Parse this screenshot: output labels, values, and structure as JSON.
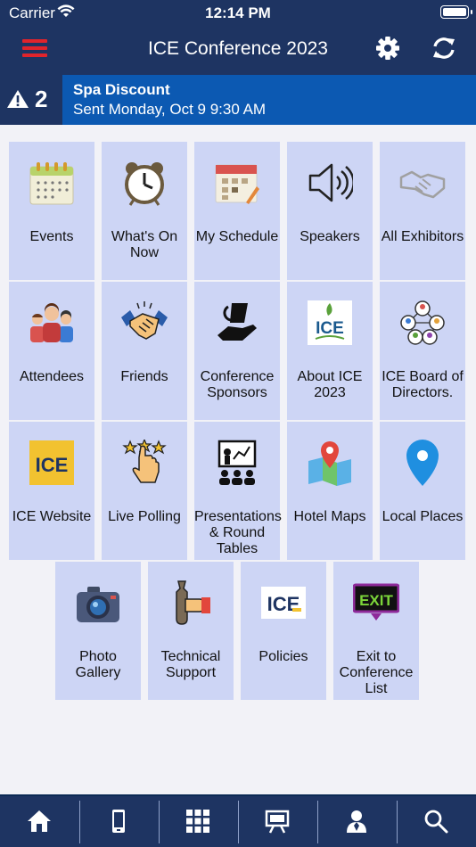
{
  "status_bar": {
    "carrier": "Carrier",
    "time": "12:14 PM"
  },
  "nav": {
    "title": "ICE Conference 2023"
  },
  "alert": {
    "count": "2",
    "title": "Spa Discount",
    "subtitle": "Sent Monday, Oct 9 9:30 AM"
  },
  "tiles": [
    {
      "label": "Events",
      "icon": "calendar-icon"
    },
    {
      "label": "What's On Now",
      "icon": "alarm-clock-icon"
    },
    {
      "label": "My Schedule",
      "icon": "schedule-calendar-icon"
    },
    {
      "label": "Speakers",
      "icon": "speaker-icon"
    },
    {
      "label": "All Exhibitors",
      "icon": "handshake-outline-icon"
    },
    {
      "label": "Attendees",
      "icon": "people-group-icon"
    },
    {
      "label": "Friends",
      "icon": "handshake-icon"
    },
    {
      "label": "Conference Sponsors",
      "icon": "sponsor-hand-icon"
    },
    {
      "label": "About ICE 2023",
      "icon": "ice-logo-icon",
      "logo_text": "ICE"
    },
    {
      "label": "ICE Board of Directors.",
      "icon": "network-people-icon"
    },
    {
      "label": "ICE Website",
      "icon": "ice-website-logo-icon",
      "logo_text": "ICE"
    },
    {
      "label": "Live Polling",
      "icon": "star-hand-icon"
    },
    {
      "label": "Presentations & Round Tables",
      "icon": "presentation-icon"
    },
    {
      "label": "Hotel Maps",
      "icon": "map-pin-icon"
    },
    {
      "label": "Local Places",
      "icon": "location-pin-icon"
    },
    {
      "label": "Photo Gallery",
      "icon": "camera-icon"
    },
    {
      "label": "Technical Support",
      "icon": "wrench-hand-icon"
    },
    {
      "label": "Policies",
      "icon": "ice-policies-logo-icon",
      "logo_text": "ICE"
    },
    {
      "label": "Exit to Conference List",
      "icon": "exit-sign-icon",
      "logo_text": "EXIT"
    }
  ],
  "tab_bar": [
    {
      "name": "tab-home",
      "icon": "home-icon"
    },
    {
      "name": "tab-mobile",
      "icon": "phone-icon"
    },
    {
      "name": "tab-grid",
      "icon": "grid-icon"
    },
    {
      "name": "tab-presentation",
      "icon": "easel-icon"
    },
    {
      "name": "tab-profile",
      "icon": "person-icon"
    },
    {
      "name": "tab-search",
      "icon": "search-icon"
    }
  ],
  "colors": {
    "header": "#1e3462",
    "alert": "#0c59b2",
    "tile": "#cdd5f5",
    "menu": "#e0242c"
  }
}
